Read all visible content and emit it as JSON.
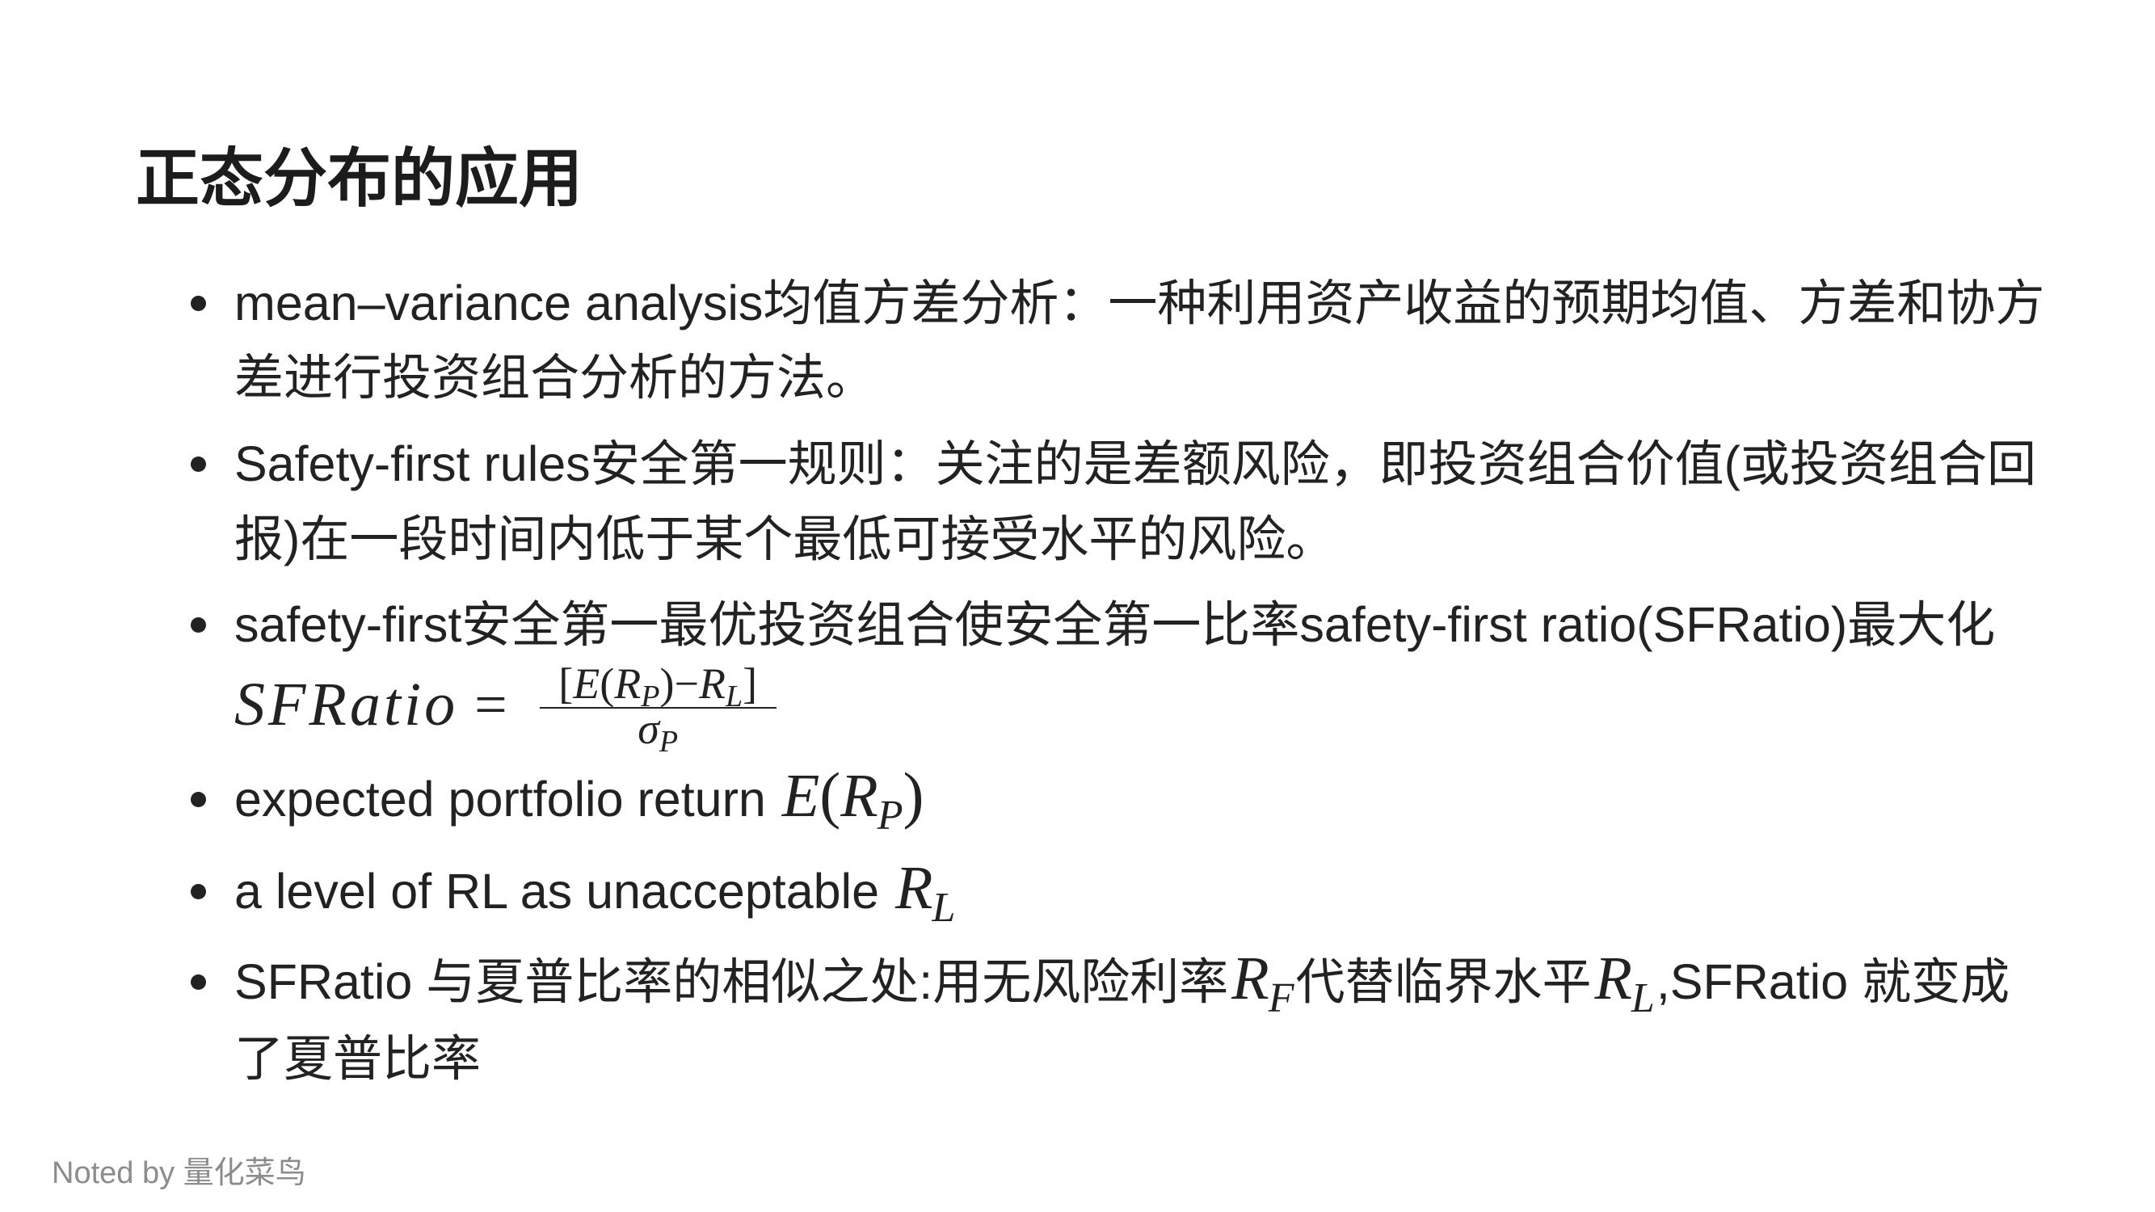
{
  "slide": {
    "title": "正态分布的应用",
    "bullets": [
      {
        "lines": [
          "mean–variance analysis均值方差分析：一种利用资产收益的预期均值、方差和协方",
          "差进行投资组合分析的方法。"
        ]
      },
      {
        "lines": [
          "Safety-first rules安全第一规则：关注的是差额风险，即投资组合价值(或投资组合回",
          "报)在一段时间内低于某个最低可接受水平的风险。"
        ]
      },
      {
        "text": "safety-first安全第一最优投资组合使安全第一比率safety-first ratio(SFRatio)最大化",
        "formula": {
          "lhs": "SFRatio",
          "eq": "=",
          "numerator": {
            "lb": "[",
            "e": "E",
            "lp": "(",
            "r1": "R",
            "r1_sub": "P",
            "rp": ")",
            "minus": "−",
            "r2": "R",
            "r2_sub": "L",
            "rb": "]"
          },
          "denominator": {
            "sym": "σ",
            "sub": "P"
          }
        }
      },
      {
        "text": "expected portfolio return",
        "math": {
          "e": "E",
          "lp": "(",
          "r": "R",
          "sub": "P",
          "rp": ")"
        }
      },
      {
        "text": "a level of RL as unacceptable",
        "math": {
          "r": "R",
          "sub": "L"
        }
      },
      {
        "segments": {
          "a": "SFRatio 与夏普比率的相似之处:用无风险利率",
          "m1": "R",
          "m1_sub": "F",
          "b": "代替临界水平",
          "m2": "R",
          "m2_sub": "L",
          "c": ",SFRatio 就变成",
          "line2": "了夏普比率"
        }
      }
    ],
    "footer": "Noted by 量化菜鸟"
  }
}
